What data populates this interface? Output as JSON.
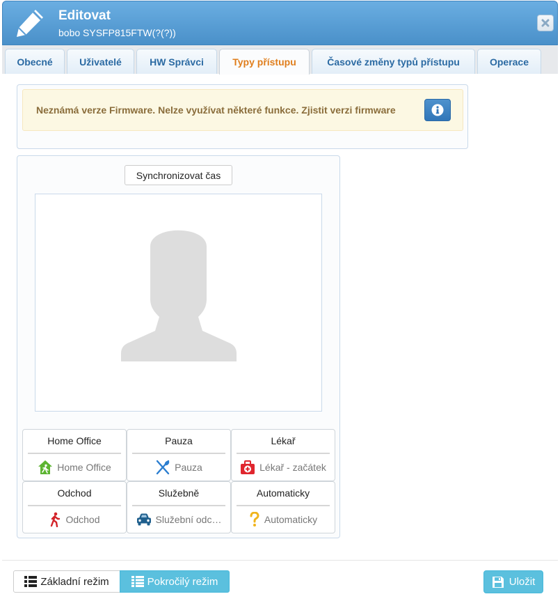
{
  "dialog": {
    "title": "Editovat",
    "subtitle": "bobo SYSFP815FTW(?(?))"
  },
  "tabs": [
    {
      "label": "Obecné",
      "active": false
    },
    {
      "label": "Uživatelé",
      "active": false
    },
    {
      "label": "HW Správci",
      "active": false
    },
    {
      "label": "Typy přístupu",
      "active": true
    },
    {
      "label": "Časové změny typů přístupu",
      "active": false
    },
    {
      "label": "Operace",
      "active": false
    }
  ],
  "warning": {
    "message": "Neznámá verze Firmware. Nelze využívat některé funkce. Zjistit verzi firmware"
  },
  "sync_button": "Synchronizovat čas",
  "access_types": [
    {
      "title": "Home Office",
      "value": "Home Office",
      "icon": "home-run-icon",
      "color": "#5cb431"
    },
    {
      "title": "Pauza",
      "value": "Pauza",
      "icon": "cutlery-icon",
      "color": "#2b7ed0"
    },
    {
      "title": "Lékař",
      "value": "Lékař - začátek",
      "icon": "first-aid-kit-icon",
      "color": "#e0262e"
    },
    {
      "title": "Odchod",
      "value": "Odchod",
      "icon": "walking-person-icon",
      "color": "#d3242a"
    },
    {
      "title": "Služebně",
      "value": "Služební odc…",
      "icon": "car-icon",
      "color": "#1f5f8d"
    },
    {
      "title": "Automaticky",
      "value": "Automaticky",
      "icon": "question-mark-icon",
      "color": "#f0b41c"
    }
  ],
  "footer": {
    "basic_mode": "Základní režim",
    "advanced_mode": "Pokročilý režim",
    "save": "Uložit"
  },
  "colors": {
    "header": "#4a90c9",
    "tab_active_text": "#e07e1c",
    "info_button": "#5bc0de"
  }
}
